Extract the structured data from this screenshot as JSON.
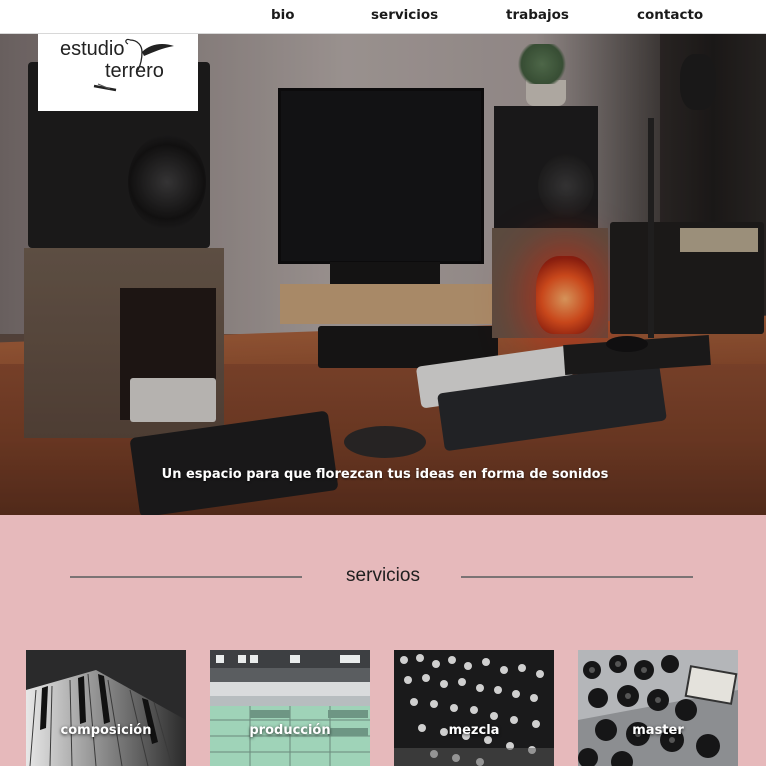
{
  "nav": {
    "items": [
      {
        "label": "bio"
      },
      {
        "label": "servicios"
      },
      {
        "label": "trabajos"
      },
      {
        "label": "contacto"
      }
    ]
  },
  "logo": {
    "line1": "estudio",
    "line2": "terrero"
  },
  "hero": {
    "tagline": "Un espacio para que florezcan tus ideas en forma de sonidos"
  },
  "services": {
    "title": "servicios",
    "cards": [
      {
        "label": "composición",
        "image": "piano-keys"
      },
      {
        "label": "producción",
        "image": "daw-screen"
      },
      {
        "label": "mezcla",
        "image": "mixing-console"
      },
      {
        "label": "master",
        "image": "mastering-knobs"
      }
    ]
  },
  "colors": {
    "section_bg": "#e6b9bb",
    "nav_bg": "#ffffff",
    "text": "#1a1a1a"
  }
}
